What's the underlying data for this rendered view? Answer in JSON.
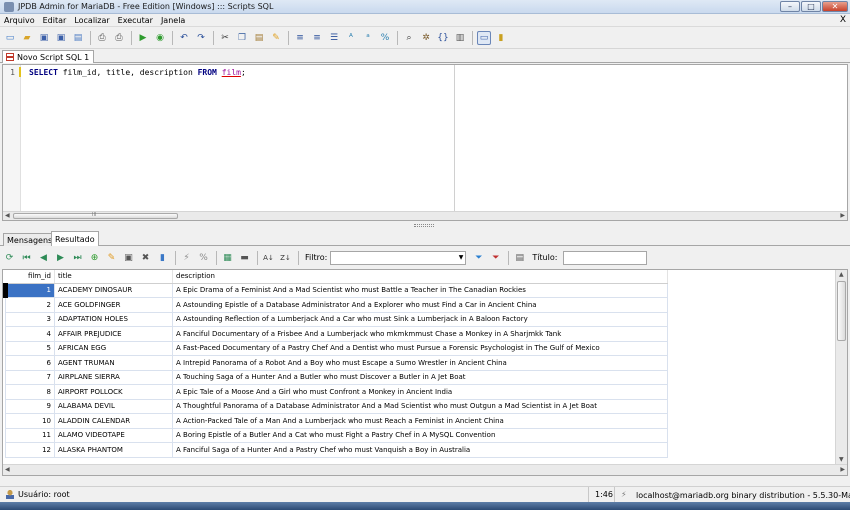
{
  "window": {
    "title": "JPDB Admin for MariaDB - Free Edition [Windows] ::: Scripts SQL",
    "controls": [
      "minimize-icon",
      "maximize-icon",
      "close-icon"
    ]
  },
  "menu": {
    "items": [
      "Arquivo",
      "Editar",
      "Localizar",
      "Executar",
      "Janela"
    ],
    "close_glyph": "X"
  },
  "toolbar": {
    "icons": [
      "new-icon",
      "open-icon",
      "save-icon",
      "save-as-icon",
      "close-script-icon",
      "print-preview-icon",
      "print-icon",
      "run-icon",
      "run-step-icon",
      "undo-icon",
      "redo-icon",
      "cut-icon",
      "copy-icon",
      "paste-icon",
      "clear-icon",
      "indent-icon",
      "unindent-icon",
      "format-icon",
      "uppercase-icon",
      "lowercase-icon",
      "comment-icon",
      "search-icon",
      "settings-icon",
      "brackets-icon",
      "script-icon",
      "panel-icon",
      "chart-icon"
    ]
  },
  "doc_tab": {
    "label": "Novo Script SQL 1"
  },
  "editor": {
    "line_number": "1",
    "keyword_select": "SELECT",
    "columns": " film_id, title, description ",
    "keyword_from": "FROM",
    "table": "film",
    "terminator": ";",
    "h_thumb_grip": "III"
  },
  "result_tabs": [
    "Mensagens",
    "Resultado"
  ],
  "result_toolbar": {
    "filter_label": "Filtro:",
    "filter_value": "",
    "title_label": "Título:",
    "title_value": "",
    "icons": [
      "refresh-icon",
      "first-icon",
      "prev-icon",
      "next-icon",
      "last-icon",
      "add-row-icon",
      "edit-row-icon",
      "save-row-icon",
      "delete-row-icon",
      "cancel-icon",
      "cut-col-icon",
      "percent-icon",
      "grid-icon",
      "form-icon",
      "sort-asc-icon",
      "sort-desc-icon",
      "filter-apply-icon",
      "filter-clear-icon",
      "title-icon"
    ]
  },
  "grid": {
    "columns": [
      "film_id",
      "title",
      "description"
    ],
    "rows": [
      {
        "film_id": "1",
        "title": "ACADEMY DINOSAUR",
        "description": "A Epic Drama of a Feminist And a Mad Scientist who must Battle a Teacher in The Canadian Rockies"
      },
      {
        "film_id": "2",
        "title": "ACE GOLDFINGER",
        "description": "A Astounding Epistle of a Database Administrator And a Explorer who must Find a Car in Ancient China"
      },
      {
        "film_id": "3",
        "title": "ADAPTATION HOLES",
        "description": "A Astounding Reflection of a Lumberjack And a Car who must Sink a Lumberjack in A Baloon Factory"
      },
      {
        "film_id": "4",
        "title": "AFFAIR PREJUDICE",
        "description": "A Fanciful Documentary of a Frisbee And a Lumberjack who mkmkmmust Chase a Monkey in A Sharjmkk Tank"
      },
      {
        "film_id": "5",
        "title": "AFRICAN EGG",
        "description": "A Fast-Paced Documentary of a Pastry Chef And a Dentist who must Pursue a Forensic Psychologist in The Gulf of Mexico"
      },
      {
        "film_id": "6",
        "title": "AGENT TRUMAN",
        "description": "A Intrepid Panorama of a Robot And a Boy who must Escape a Sumo Wrestler in Ancient China"
      },
      {
        "film_id": "7",
        "title": "AIRPLANE SIERRA",
        "description": "A Touching Saga of a Hunter And a Butler who must Discover a Butler in A Jet Boat"
      },
      {
        "film_id": "8",
        "title": "AIRPORT POLLOCK",
        "description": "A Epic Tale of a Moose And a Girl who must Confront a Monkey in Ancient India"
      },
      {
        "film_id": "9",
        "title": "ALABAMA DEVIL",
        "description": "A Thoughtful Panorama of a Database Administrator And a Mad Scientist who must Outgun a Mad Scientist in A Jet Boat"
      },
      {
        "film_id": "10",
        "title": "ALADDIN CALENDAR",
        "description": "A Action-Packed Tale of a Man And a Lumberjack who must Reach a Feminist in Ancient China"
      },
      {
        "film_id": "11",
        "title": "ALAMO VIDEOTAPE",
        "description": "A Boring Epistle of a Butler And a Cat who must Fight a Pastry Chef in A MySQL Convention"
      },
      {
        "film_id": "12",
        "title": "ALASKA PHANTOM",
        "description": "A Fanciful Saga of a Hunter And a Pastry Chef who must Vanquish a Boy in Australia"
      }
    ],
    "selected_row": 0
  },
  "status": {
    "user": "Usuário: root",
    "cursor": "1:46",
    "connection": "localhost@mariadb.org binary distribution - 5.5.30-MariaDB"
  }
}
